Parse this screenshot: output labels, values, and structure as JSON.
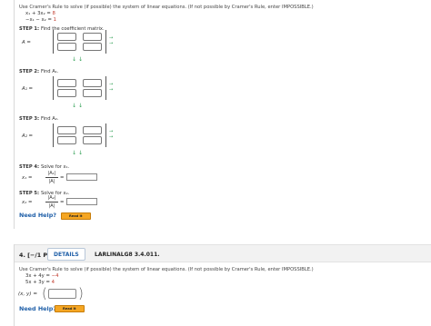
{
  "q3": {
    "intro": "Use Cramer's Rule to solve (if possible) the system of linear equations. (If not possible by Cramer's Rule, enter IMPOSSIBLE.)",
    "equations": [
      {
        "lhs": "x₁ + 3x₂ =",
        "rhs": "8"
      },
      {
        "lhs": "−x₁ − x₂ =",
        "rhs": "1"
      }
    ],
    "step1": {
      "label": "STEP 1:",
      "text": "Find the coefficient matrix.",
      "matrix_label": "A ="
    },
    "step2": {
      "label": "STEP 2:",
      "text": "Find A₁.",
      "matrix_label": "A₁ ="
    },
    "step3": {
      "label": "STEP 3:",
      "text": "Find A₂.",
      "matrix_label": "A₂ ="
    },
    "step4": {
      "label": "STEP 4:",
      "text": "Solve for x₁.",
      "var": "x₁ =",
      "num": "|A₁|",
      "den": "|A|",
      "eq": "="
    },
    "step5": {
      "label": "STEP 5:",
      "text": "Solve for x₂.",
      "var": "x₂ =",
      "num": "|A₂|",
      "den": "|A|",
      "eq": "="
    },
    "need_help": "Need Help?",
    "read_it": "Read It",
    "arrows": {
      "right": "→",
      "down": "↓↓"
    }
  },
  "q4": {
    "number": "4. [−/1 Points]",
    "details": "DETAILS",
    "code": "LARLINALG8 3.4.011.",
    "intro": "Use Cramer's Rule to solve (if possible) the system of linear equations. (If not possible by Cramer's Rule, enter IMPOSSIBLE.)",
    "equations": [
      {
        "lhs": "3x + 4y =",
        "rhs": "−4"
      },
      {
        "lhs": "5x + 3y =",
        "rhs": "4"
      }
    ],
    "answer_label": "(x, y) =",
    "paren_open": "(",
    "paren_close": ")",
    "need_help": "Need Help?",
    "read_it": "Read It"
  },
  "colors": {
    "need_help": "#1f5fa8",
    "read_it_bg": "#f5a623",
    "arrow": "#2a9d4f",
    "answer_value": "#c0392b"
  }
}
